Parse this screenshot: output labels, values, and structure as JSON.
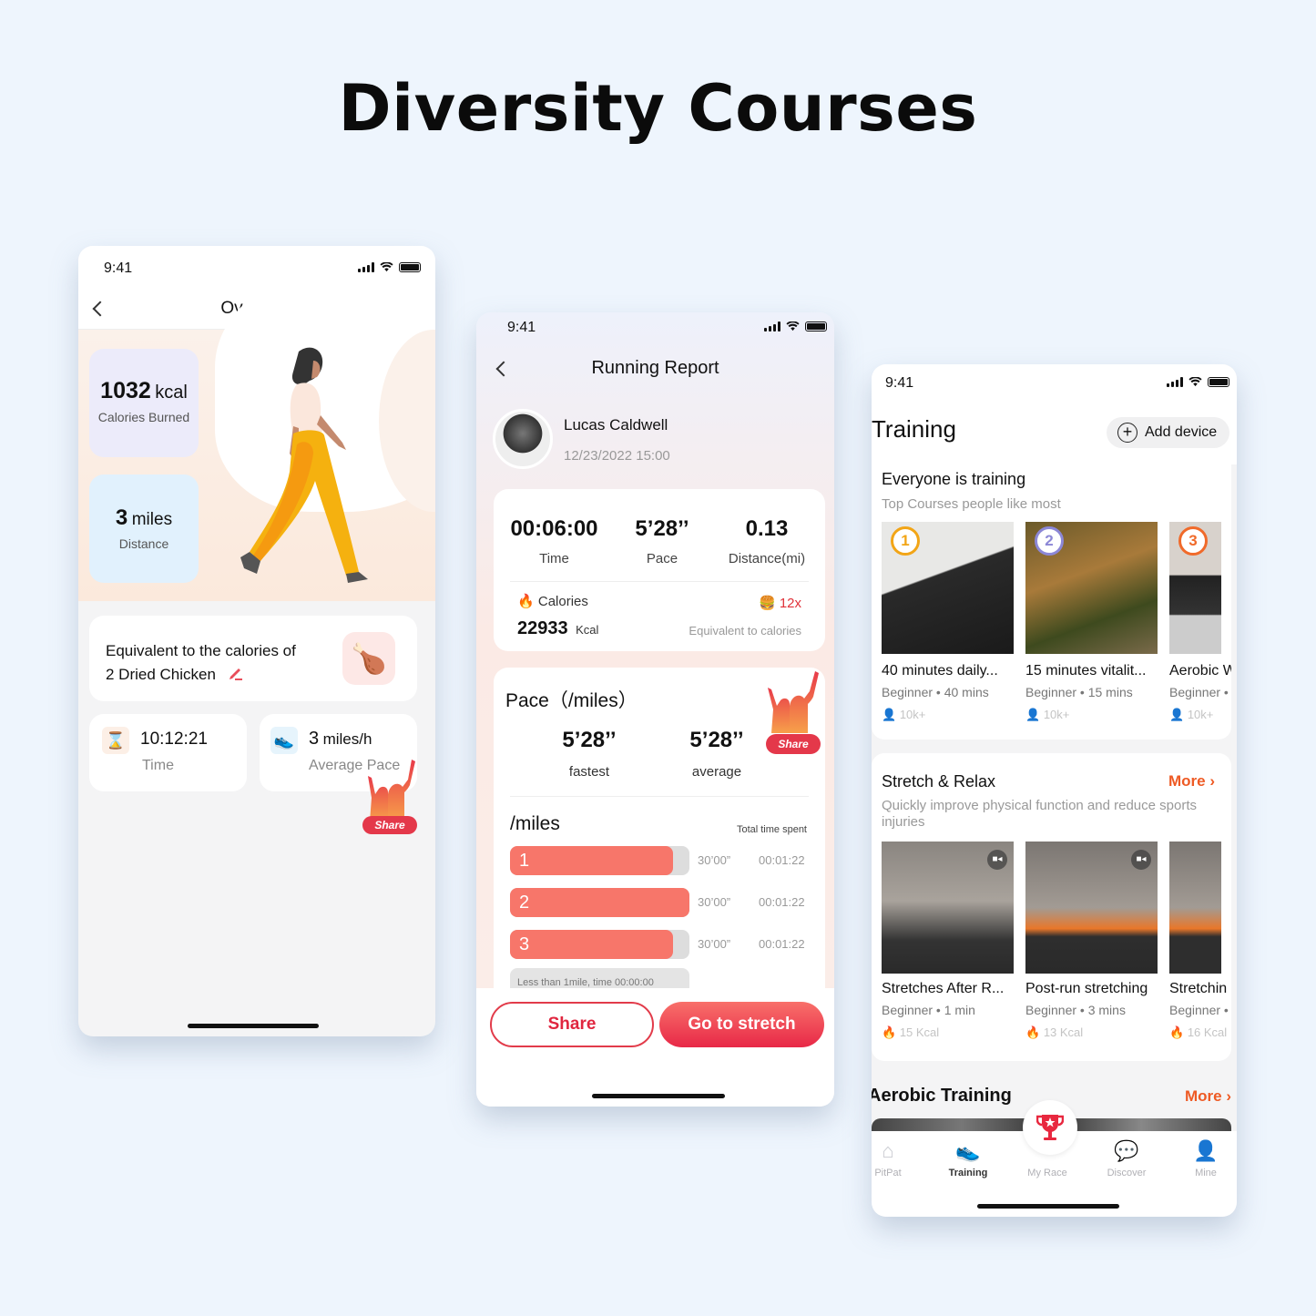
{
  "headline": "Diversity Courses",
  "overview_screen": {
    "status_time": "9:41",
    "title": "Overview",
    "calories_value": "1032",
    "calories_unit": "kcal",
    "calories_label": "Calories Burned",
    "distance_value": "3",
    "distance_unit": "miles",
    "distance_label": "Distance",
    "equivalent_line1": "Equivalent to the calories of",
    "equivalent_line2": "2 Dried Chicken",
    "time_value": "10:12:21",
    "time_label": "Time",
    "pace_value": "3",
    "pace_unit": "miles/h",
    "pace_label": "Average Pace",
    "share_badge": "Share"
  },
  "running_report": {
    "status_time": "9:41",
    "title": "Running Report",
    "user_name": "Lucas Caldwell",
    "datetime": "12/23/2022 15:00",
    "stats": [
      {
        "value": "00:06:00",
        "label": "Time"
      },
      {
        "value": "5’28’’",
        "label": "Pace"
      },
      {
        "value": "0.13",
        "label": "Distance(mi)"
      }
    ],
    "calories_label": "Calories",
    "calories_value": "22933",
    "calories_unit": "Kcal",
    "equivalent_multiplier": "12x",
    "equivalent_label": "Equivalent to calories",
    "pace_title": "Pace（/miles）",
    "fastest_value": "5’28’’",
    "fastest_label": "fastest",
    "average_value": "5’28’’",
    "average_label": "average",
    "share_badge": "Share",
    "splits_title": "/miles",
    "splits_header": "Total time spent",
    "splits": [
      {
        "mile": "1",
        "pace": "30’00”",
        "total": "00:01:22",
        "fill_pct": 91
      },
      {
        "mile": "2",
        "pace": "30’00”",
        "total": "00:01:22",
        "fill_pct": 100
      },
      {
        "mile": "3",
        "pace": "30’00”",
        "total": "00:01:22",
        "fill_pct": 91
      }
    ],
    "less_than_note": "Less than 1mile, time 00:00:00",
    "share_button": "Share",
    "stretch_button": "Go to stretch",
    "accent": "#e8283f"
  },
  "training_screen": {
    "status_time": "9:41",
    "title": "Training",
    "add_device": "Add device",
    "everyone_title": "Everyone is training",
    "everyone_subtitle": "Top Courses people like most",
    "top_courses": [
      {
        "rank": "1",
        "title": "40 minutes daily...",
        "meta": "Beginner • 40 mins",
        "users": "10k+",
        "medal_color": "#f2a516"
      },
      {
        "rank": "2",
        "title": "15 minutes vitalit...",
        "meta": "Beginner • 15 mins",
        "users": "10k+",
        "medal_color": "#8c87d6"
      },
      {
        "rank": "3",
        "title": "Aerobic W",
        "meta": "Beginner •",
        "users": "10k+",
        "medal_color": "#f06a2a"
      }
    ],
    "stretch_title": "Stretch & Relax",
    "stretch_more": "More",
    "stretch_subtitle": "Quickly improve physical function and reduce sports injuries",
    "stretch_courses": [
      {
        "title": "Stretches After R...",
        "meta": "Beginner • 1 min",
        "kcal": "15 Kcal"
      },
      {
        "title": "Post-run stretching",
        "meta": "Beginner • 3 mins",
        "kcal": "13 Kcal"
      },
      {
        "title": "Stretchin",
        "meta": "Beginner •",
        "kcal": "16 Kcal"
      }
    ],
    "aerobic_title": "Aerobic Training",
    "aerobic_more": "More",
    "tabs": [
      {
        "label": "PitPat",
        "active": false
      },
      {
        "label": "Training",
        "active": true
      },
      {
        "label": "My Race",
        "active": false
      },
      {
        "label": "Discover",
        "active": false
      },
      {
        "label": "Mine",
        "active": false
      }
    ],
    "more_color": "#ee5a24"
  }
}
